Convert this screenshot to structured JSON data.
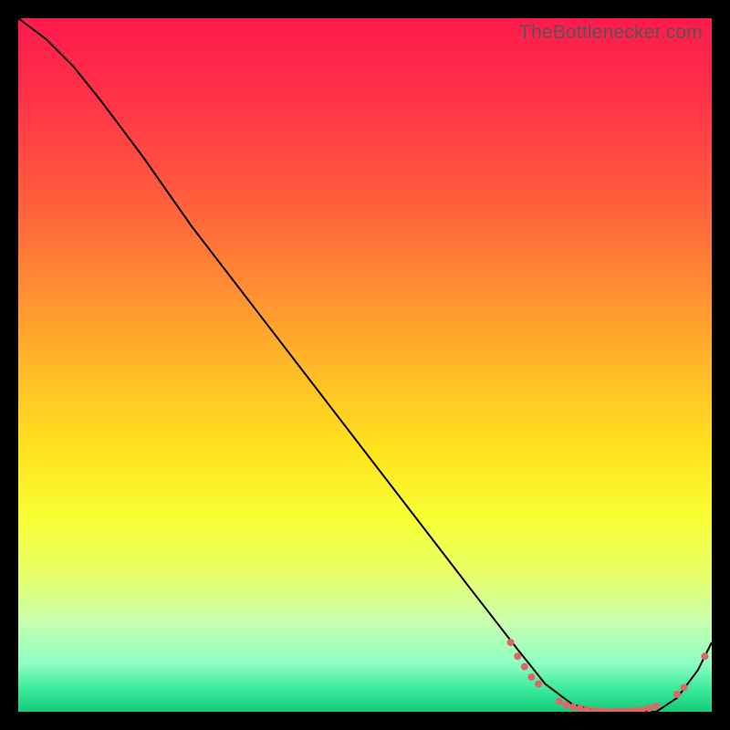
{
  "watermark": "TheBottlenecker.com",
  "chart_data": {
    "type": "line",
    "title": "",
    "xlabel": "",
    "ylabel": "",
    "xlim": [
      0,
      100
    ],
    "ylim": [
      0,
      100
    ],
    "background_gradient": {
      "stops": [
        {
          "offset": 0.0,
          "color": "#ff1a4d"
        },
        {
          "offset": 0.12,
          "color": "#ff3348"
        },
        {
          "offset": 0.25,
          "color": "#ff5a3d"
        },
        {
          "offset": 0.38,
          "color": "#ff8a33"
        },
        {
          "offset": 0.5,
          "color": "#ffb828"
        },
        {
          "offset": 0.62,
          "color": "#ffe21e"
        },
        {
          "offset": 0.72,
          "color": "#f7ff33"
        },
        {
          "offset": 0.8,
          "color": "#e8ff66"
        },
        {
          "offset": 0.87,
          "color": "#caffb0"
        },
        {
          "offset": 0.93,
          "color": "#8effc2"
        },
        {
          "offset": 0.97,
          "color": "#35e89a"
        },
        {
          "offset": 1.0,
          "color": "#18c97a"
        }
      ]
    },
    "series": [
      {
        "name": "bottleneck-curve",
        "color": "#000000",
        "stroke_width": 2,
        "x": [
          0,
          4,
          8,
          12,
          18,
          25,
          35,
          45,
          55,
          65,
          72,
          76,
          80,
          84,
          88,
          92,
          95,
          98,
          100
        ],
        "y": [
          100,
          97,
          93,
          88,
          80,
          70,
          57,
          44,
          31,
          18,
          9,
          4,
          1,
          0,
          0,
          0,
          2,
          6,
          10
        ]
      }
    ],
    "markers": {
      "name": "points",
      "color": "#e06666",
      "radius": 4,
      "points": [
        {
          "x": 71,
          "y": 10
        },
        {
          "x": 72,
          "y": 8
        },
        {
          "x": 73,
          "y": 6.5
        },
        {
          "x": 74,
          "y": 5
        },
        {
          "x": 75,
          "y": 4
        },
        {
          "x": 78,
          "y": 1.5
        },
        {
          "x": 79,
          "y": 1
        },
        {
          "x": 80,
          "y": 0.7
        },
        {
          "x": 81,
          "y": 0.5
        },
        {
          "x": 82,
          "y": 0.3
        },
        {
          "x": 83,
          "y": 0.2
        },
        {
          "x": 84,
          "y": 0.1
        },
        {
          "x": 85,
          "y": 0.1
        },
        {
          "x": 86,
          "y": 0.1
        },
        {
          "x": 87,
          "y": 0.1
        },
        {
          "x": 88,
          "y": 0.1
        },
        {
          "x": 89,
          "y": 0.2
        },
        {
          "x": 90,
          "y": 0.3
        },
        {
          "x": 91,
          "y": 0.5
        },
        {
          "x": 92,
          "y": 0.8
        },
        {
          "x": 95,
          "y": 2.5
        },
        {
          "x": 96,
          "y": 3.5
        },
        {
          "x": 99,
          "y": 8
        }
      ]
    }
  }
}
